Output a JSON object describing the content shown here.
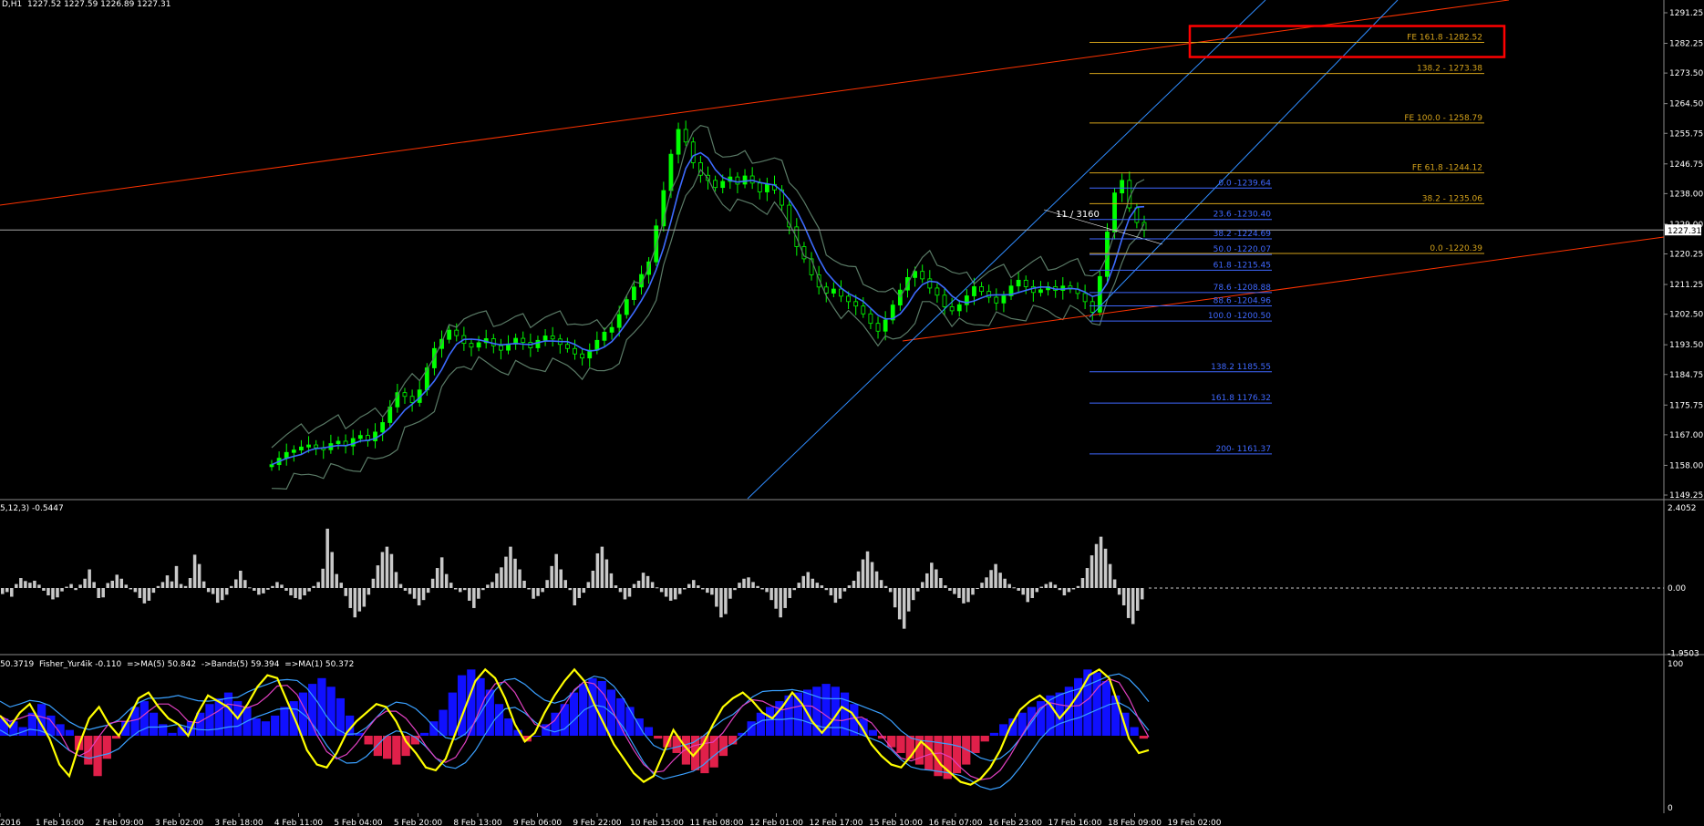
{
  "header": {
    "price_info": "D,H1  1227.52 1227.59 1226.89 1227.31",
    "macd_info": "5,12,3) -0.5447",
    "fisher_info": "50.3719  Fisher_Yur4ik -0.110  =>MA(5) 50.842  ->Bands(5) 59.394  =>MA(1) 50.372"
  },
  "colors": {
    "background": "#000000",
    "bull_candle": "#00ff00",
    "ma_line": "#3d6bff",
    "bands": "#5a7a66",
    "channel_red": "#ff3300",
    "channel_blue": "#2f8cff",
    "fibo_gold": "#d4a21a",
    "fibo_blue": "#3f68ff",
    "hist_gray": "#c8c8c8",
    "fisher_blue": "#1010ff",
    "fisher_red": "#e0204a",
    "fisher_yellow": "#ffff00",
    "highlight_box": "#ff0000"
  },
  "chart_data": [
    {
      "type": "candlestick",
      "title": "",
      "ylim": [
        1149.25,
        1295.0
      ],
      "yticks": [
        "1291.25",
        "1282.25",
        "1273.50",
        "1264.50",
        "1255.75",
        "1246.75",
        "1238.00",
        "1229.00",
        "1220.25",
        "1211.25",
        "1202.50",
        "1193.50",
        "1184.75",
        "1175.75",
        "1167.00",
        "1158.00",
        "1149.25"
      ],
      "current_price": "1227.31",
      "closes": [
        1158.2,
        1160.1,
        1161.8,
        1162.5,
        1163.4,
        1164.0,
        1163.2,
        1162.6,
        1164.4,
        1165.1,
        1163.7,
        1165.9,
        1166.8,
        1165.2,
        1167.8,
        1170.6,
        1175.2,
        1179.4,
        1178.3,
        1176.5,
        1180.2,
        1186.7,
        1192.4,
        1195.1,
        1197.8,
        1196.2,
        1193.9,
        1192.8,
        1194.1,
        1195.3,
        1193.2,
        1191.9,
        1193.7,
        1195.4,
        1194.2,
        1192.6,
        1194.8,
        1196.1,
        1195.2,
        1193.6,
        1192.4,
        1190.8,
        1189.6,
        1191.9,
        1194.8,
        1197.2,
        1198.6,
        1202.4,
        1206.8,
        1210.5,
        1214.2,
        1217.9,
        1228.5,
        1238.9,
        1249.6,
        1256.9,
        1253.2,
        1247.1,
        1243.4,
        1241.9,
        1239.8,
        1241.6,
        1242.9,
        1240.8,
        1243.2,
        1241.1,
        1238.5,
        1240.7,
        1239.1,
        1234.6,
        1228.2,
        1222.4,
        1218.8,
        1214.1,
        1210.5,
        1208.7,
        1209.9,
        1207.8,
        1206.2,
        1204.9,
        1202.6,
        1199.8,
        1197.5,
        1200.8,
        1205.2,
        1209.6,
        1213.3,
        1215.1,
        1212.9,
        1210.2,
        1208.1,
        1204.7,
        1203.5,
        1205.3,
        1207.9,
        1210.6,
        1209.2,
        1207.5,
        1205.8,
        1207.9,
        1210.8,
        1212.5,
        1210.6,
        1208.9,
        1209.7,
        1210.6,
        1209.5,
        1210.8,
        1209.9,
        1208.6,
        1206.2,
        1203.1,
        1213.6,
        1226.7,
        1238.2,
        1241.9,
        1233.8,
        1229.5,
        1227.31
      ],
      "moving_average_series": "MA",
      "bands_series": "Bands",
      "fibo_expansion_levels": [
        {
          "label": "FE 161.8 -1282.52",
          "price": 1282.52
        },
        {
          "label": "138.2 - 1273.38",
          "price": 1273.38
        },
        {
          "label": "FE 100.0 - 1258.79",
          "price": 1258.79
        },
        {
          "label": "FE 61.8 -1244.12",
          "price": 1244.12
        },
        {
          "label": "38.2 - 1235.06",
          "price": 1235.06
        },
        {
          "label": "0.0 -1220.39",
          "price": 1220.39
        }
      ],
      "fibo_retracement_levels": [
        {
          "label": "0.0 -1239.64",
          "price": 1239.64
        },
        {
          "label": "23.6 -1230.40",
          "price": 1230.4
        },
        {
          "label": "38.2 -1224.69",
          "price": 1224.69
        },
        {
          "label": "50.0 -1220.07",
          "price": 1220.07
        },
        {
          "label": "61.8 -1215.45",
          "price": 1215.45
        },
        {
          "label": "78.6 -1208.88",
          "price": 1208.88
        },
        {
          "label": "88.6 -1204.96",
          "price": 1204.96
        },
        {
          "label": "100.0 -1200.50",
          "price": 1200.5
        },
        {
          "label": "138.2  1185.55",
          "price": 1185.55
        },
        {
          "label": "161.8 1176.32",
          "price": 1176.32
        },
        {
          "label": "200- 1161.37",
          "price": 1161.37
        }
      ],
      "annotation": "11 / 3160"
    },
    {
      "type": "bar",
      "title": "",
      "ylim": [
        -1.9503,
        2.4052
      ],
      "yticks": [
        "2.4052",
        "0.00",
        "-1.9503"
      ],
      "values": [
        -0.18,
        -0.12,
        -0.26,
        0.12,
        0.3,
        0.21,
        0.16,
        0.22,
        0.1,
        -0.08,
        -0.22,
        -0.34,
        -0.28,
        -0.1,
        0.04,
        0.12,
        -0.06,
        0.1,
        0.28,
        0.56,
        0.18,
        -0.3,
        -0.28,
        0.15,
        0.22,
        0.4,
        0.28,
        0.1,
        -0.04,
        -0.12,
        -0.3,
        -0.46,
        -0.38,
        -0.14,
        0.06,
        0.18,
        0.38,
        0.2,
        0.66,
        0.12,
        0.06,
        0.3,
        1.0,
        0.72,
        0.2,
        -0.12,
        -0.18,
        -0.44,
        -0.36,
        -0.2,
        0.06,
        0.26,
        0.52,
        0.24,
        0.02,
        -0.08,
        -0.2,
        -0.16,
        -0.05,
        0.06,
        0.18,
        0.1,
        -0.08,
        -0.22,
        -0.3,
        -0.34,
        -0.22,
        -0.1,
        0.06,
        0.18,
        0.58,
        1.78,
        1.08,
        0.42,
        0.16,
        -0.24,
        -0.6,
        -0.88,
        -0.7,
        -0.56,
        -0.2,
        0.28,
        0.68,
        1.08,
        1.24,
        1.02,
        0.48,
        0.12,
        -0.08,
        -0.18,
        -0.32,
        -0.52,
        -0.36,
        -0.14,
        0.28,
        0.6,
        0.92,
        0.42,
        0.16,
        -0.04,
        -0.12,
        -0.06,
        -0.38,
        -0.6,
        -0.32,
        -0.06,
        0.1,
        0.18,
        0.44,
        0.62,
        0.94,
        1.24,
        0.88,
        0.56,
        0.22,
        -0.04,
        -0.32,
        -0.24,
        -0.12,
        0.24,
        0.66,
        1.02,
        0.56,
        0.24,
        -0.06,
        -0.52,
        -0.3,
        -0.14,
        0.18,
        0.52,
        1.04,
        1.24,
        0.86,
        0.44,
        0.08,
        -0.12,
        -0.34,
        -0.26,
        0.12,
        0.22,
        0.46,
        0.36,
        0.18,
        0.02,
        -0.12,
        -0.26,
        -0.38,
        -0.34,
        -0.18,
        -0.04,
        0.12,
        0.24,
        0.08,
        -0.04,
        -0.14,
        -0.2,
        -0.56,
        -0.88,
        -0.78,
        -0.32,
        -0.06,
        0.16,
        0.28,
        0.32,
        0.18,
        0.06,
        -0.04,
        -0.12,
        -0.36,
        -0.62,
        -0.88,
        -0.6,
        -0.3,
        -0.06,
        0.16,
        0.36,
        0.48,
        0.28,
        0.16,
        0.08,
        -0.06,
        -0.22,
        -0.44,
        -0.32,
        -0.1,
        0.08,
        0.22,
        0.5,
        0.86,
        1.1,
        0.78,
        0.5,
        0.24,
        0.06,
        -0.12,
        -0.58,
        -0.94,
        -1.22,
        -0.7,
        -0.36,
        -0.1,
        0.18,
        0.44,
        0.76,
        0.56,
        0.3,
        0.08,
        -0.08,
        -0.18,
        -0.3,
        -0.46,
        -0.42,
        -0.2,
        -0.02,
        0.16,
        0.32,
        0.54,
        0.72,
        0.46,
        0.28,
        0.12,
        0.02,
        -0.08,
        -0.2,
        -0.42,
        -0.3,
        -0.12,
        0.04,
        0.12,
        0.18,
        0.1,
        -0.06,
        -0.22,
        -0.12,
        -0.04,
        0.06,
        0.3,
        0.6,
        0.98,
        1.32,
        1.54,
        1.18,
        0.72,
        0.26,
        -0.2,
        -0.52,
        -0.9,
        -1.08,
        -0.68,
        -0.34
      ],
      "zero_line": "0.00"
    },
    {
      "type": "line",
      "title": "",
      "ylim": [
        0,
        100
      ],
      "yticks": [
        "100",
        "0"
      ],
      "hist_values": [
        62,
        60,
        56,
        66,
        72,
        64,
        58,
        54,
        40,
        30,
        22,
        34,
        48,
        60,
        70,
        74,
        66,
        58,
        52,
        56,
        60,
        66,
        72,
        76,
        80,
        74,
        70,
        62,
        60,
        64,
        70,
        74,
        80,
        86,
        90,
        84,
        76,
        64,
        52,
        44,
        36,
        34,
        30,
        36,
        44,
        52,
        60,
        68,
        80,
        92,
        96,
        90,
        82,
        72,
        62,
        54,
        46,
        50,
        58,
        66,
        72,
        80,
        86,
        90,
        88,
        82,
        76,
        70,
        62,
        56,
        48,
        42,
        38,
        30,
        26,
        24,
        28,
        36,
        44,
        52,
        60,
        66,
        70,
        74,
        78,
        80,
        82,
        84,
        86,
        84,
        80,
        72,
        62,
        54,
        48,
        42,
        38,
        34,
        30,
        26,
        22,
        20,
        24,
        30,
        38,
        46,
        52,
        58,
        62,
        66,
        70,
        74,
        78,
        80,
        84,
        90,
        96,
        94,
        88,
        78,
        66,
        56,
        48
      ],
      "fisher_values": [
        64,
        56,
        66,
        72,
        60,
        48,
        30,
        22,
        44,
        62,
        70,
        58,
        50,
        62,
        76,
        80,
        70,
        62,
        58,
        50,
        66,
        78,
        74,
        70,
        62,
        72,
        84,
        92,
        90,
        74,
        58,
        40,
        30,
        28,
        38,
        52,
        60,
        66,
        72,
        70,
        60,
        46,
        38,
        28,
        26,
        34,
        52,
        70,
        88,
        96,
        90,
        76,
        58,
        46,
        52,
        66,
        78,
        88,
        96,
        88,
        72,
        58,
        44,
        34,
        24,
        18,
        22,
        38,
        54,
        44,
        36,
        44,
        58,
        70,
        76,
        80,
        74,
        66,
        62,
        70,
        80,
        72,
        60,
        52,
        60,
        70,
        66,
        56,
        44,
        36,
        30,
        28,
        36,
        46,
        40,
        30,
        24,
        18,
        16,
        20,
        28,
        40,
        56,
        68,
        74,
        78,
        72,
        62,
        70,
        80,
        92,
        96,
        90,
        70,
        48,
        38,
        40
      ],
      "band_series": [
        "Bands",
        "MA(5)",
        "MA(1)"
      ],
      "x_tick_labels": [
        "2016",
        "1 Feb 16:00",
        "2 Feb 09:00",
        "3 Feb 02:00",
        "3 Feb 18:00",
        "4 Feb 11:00",
        "5 Feb 04:00",
        "5 Feb 20:00",
        "8 Feb 13:00",
        "9 Feb 06:00",
        "9 Feb 22:00",
        "10 Feb 15:00",
        "11 Feb 08:00",
        "12 Feb 01:00",
        "12 Feb 17:00",
        "15 Feb 10:00",
        "16 Feb 07:00",
        "16 Feb 23:00",
        "17 Feb 16:00",
        "18 Feb 09:00",
        "19 Feb 02:00"
      ]
    }
  ]
}
